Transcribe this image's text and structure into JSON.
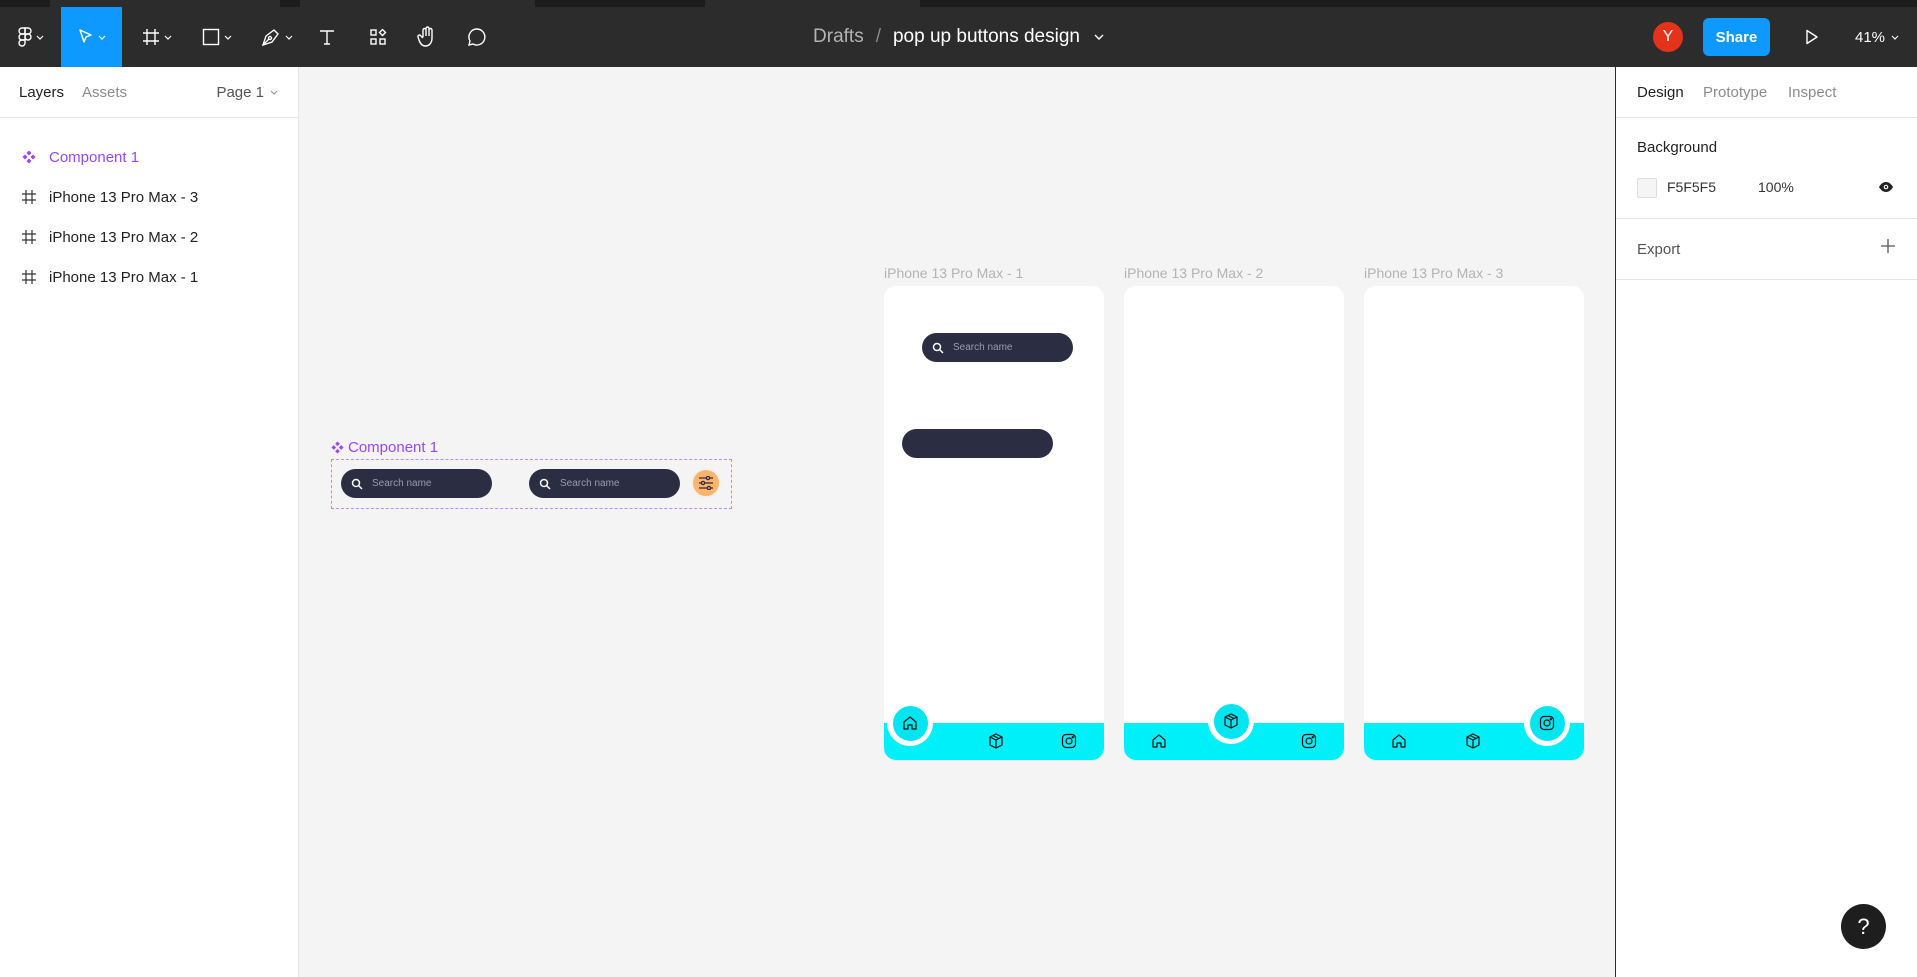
{
  "toolbar": {
    "tools": [
      "main-menu",
      "move",
      "frame",
      "shape",
      "pen",
      "text",
      "resources",
      "hand",
      "comment"
    ],
    "breadcrumb": {
      "project": "Drafts",
      "separator": "/",
      "file": "pop up buttons design"
    },
    "avatar_initial": "Y",
    "share_label": "Share",
    "zoom_label": "41%"
  },
  "left_panel": {
    "tabs": [
      "Layers",
      "Assets"
    ],
    "page_selector": "Page 1",
    "layers": [
      {
        "label": "Component 1",
        "icon": "component-icon"
      },
      {
        "label": "iPhone 13 Pro Max - 3",
        "icon": "frame-icon"
      },
      {
        "label": "iPhone 13 Pro Max - 2",
        "icon": "frame-icon"
      },
      {
        "label": "iPhone 13 Pro Max - 1",
        "icon": "frame-icon"
      }
    ]
  },
  "right_panel": {
    "tabs": [
      "Design",
      "Prototype",
      "Inspect"
    ],
    "background": {
      "title": "Background",
      "hex": "F5F5F5",
      "opacity": "100%",
      "color": "#f5f5f5"
    },
    "export": {
      "title": "Export"
    }
  },
  "canvas": {
    "component": {
      "label": "Component 1",
      "search_placeholder": "Search name"
    },
    "frames": [
      {
        "label": "iPhone 13 Pro Max - 1",
        "search_placeholder": "Search name",
        "active_nav": "home"
      },
      {
        "label": "iPhone 13 Pro Max - 2",
        "active_nav": "box"
      },
      {
        "label": "iPhone 13 Pro Max - 3",
        "active_nav": "instagram"
      }
    ]
  },
  "help_label": "?",
  "colors": {
    "accent": "#0d99ff",
    "component": "#9747ff",
    "navbar": "#00f0fa",
    "search_pill": "#2b2d42",
    "filter_button": "#ffb36b"
  }
}
